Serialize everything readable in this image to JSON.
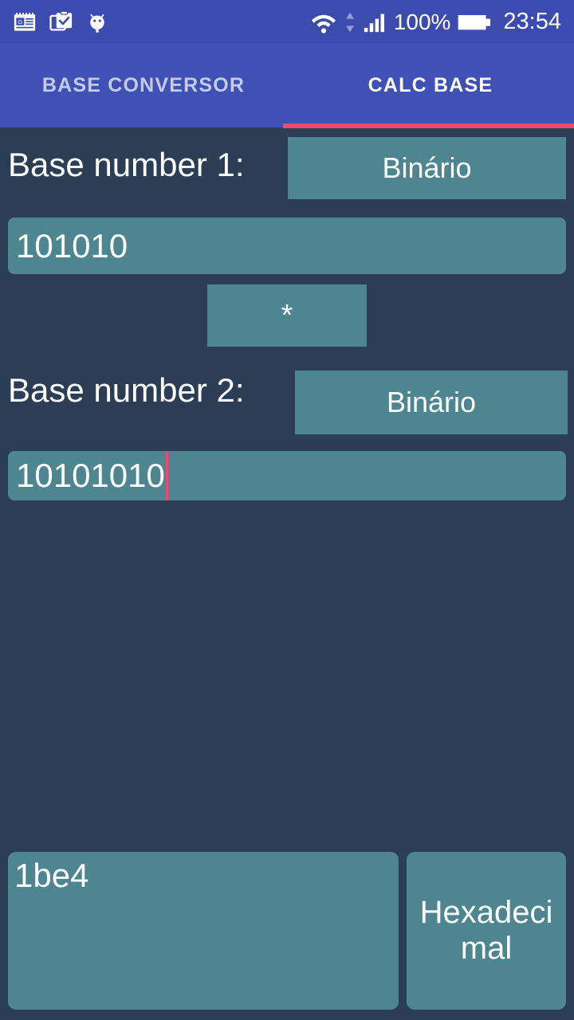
{
  "status_bar": {
    "icons_left": [
      "news-icon",
      "clipboard-check-icon",
      "android-usb-debug-icon"
    ],
    "wifi_icon": "wifi-icon",
    "data-transfer_icon": "data-transfer-arrows-icon",
    "signal_icon": "cellular-signal-icon",
    "battery_percent": "100%",
    "battery_icon": "battery-full-icon",
    "clock": "23:54",
    "background_color": "#3b4bae",
    "foreground_color": "#ffffff"
  },
  "tabs": {
    "items": [
      {
        "label": "BASE CONVERSOR",
        "active": false
      },
      {
        "label": "CALC BASE",
        "active": true
      }
    ],
    "indicator_color": "#ec4874",
    "bar_color": "#3f51b5"
  },
  "main": {
    "background_color": "#2b3e55",
    "field_color": "#4d8590",
    "base1": {
      "label": "Base number 1:",
      "base_spinner_value": "Binário",
      "input_value": "101010",
      "input_placeholder": ""
    },
    "operator": {
      "value": "*"
    },
    "base2": {
      "label": "Base number 2:",
      "base_spinner_value": "Binário",
      "input_value": "10101010",
      "input_placeholder": "",
      "caret_color": "#ec4874"
    },
    "result": {
      "value": "1be4",
      "base_label": "Hexadecimal"
    }
  }
}
